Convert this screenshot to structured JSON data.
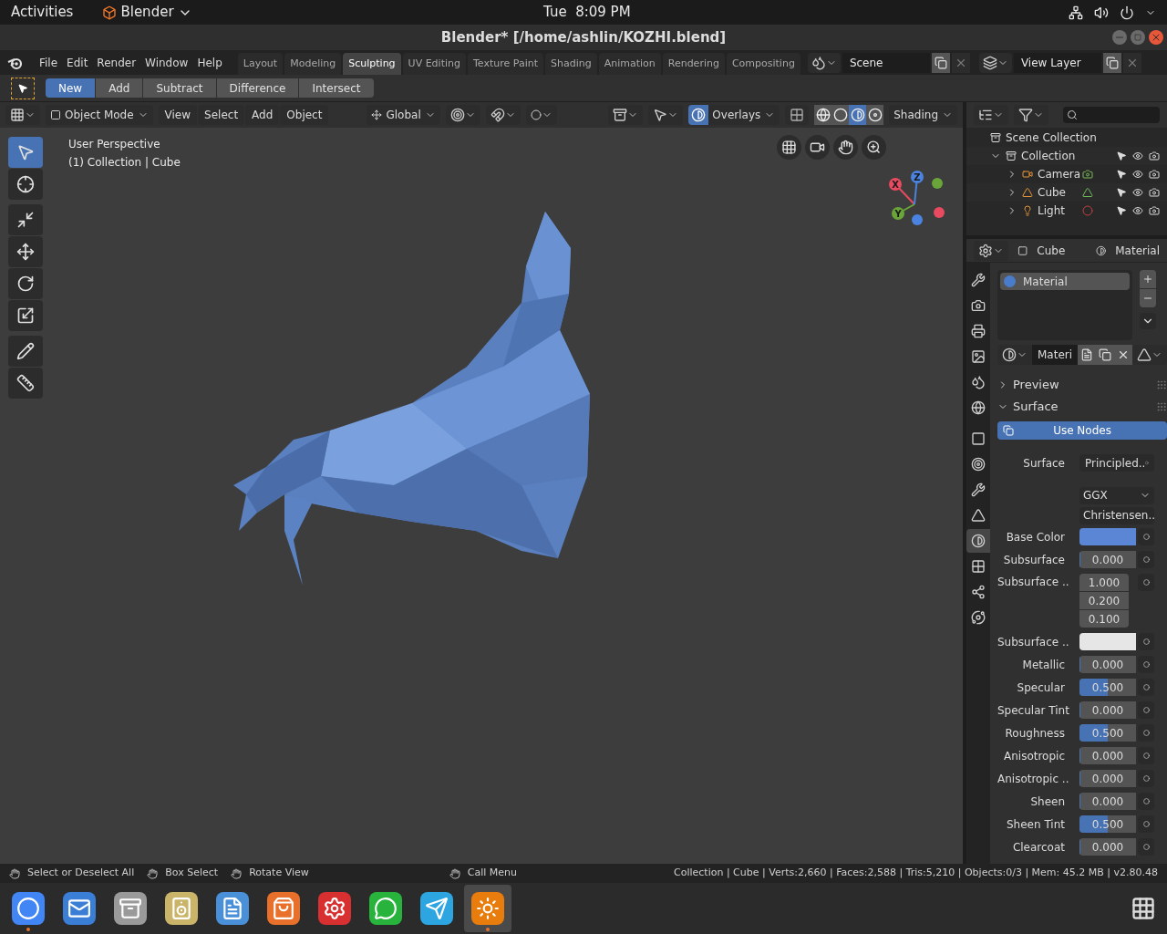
{
  "system_bar": {
    "activities": "Activities",
    "app_menu": "Blender",
    "clock": "Tue  8:09 PM"
  },
  "window": {
    "title": "Blender* [/home/ashlin/KOZHI.blend]"
  },
  "menu": [
    "File",
    "Edit",
    "Render",
    "Window",
    "Help"
  ],
  "workspace_tabs": [
    {
      "label": "Layout",
      "selected": false
    },
    {
      "label": "Modeling",
      "selected": false
    },
    {
      "label": "Sculpting",
      "selected": true
    },
    {
      "label": "UV Editing",
      "selected": false
    },
    {
      "label": "Texture Paint",
      "selected": false
    },
    {
      "label": "Shading",
      "selected": false
    },
    {
      "label": "Animation",
      "selected": false
    },
    {
      "label": "Rendering",
      "selected": false
    },
    {
      "label": "Compositing",
      "selected": false
    }
  ],
  "scene": "Scene",
  "view_layer": "View Layer",
  "tool_modes": [
    {
      "label": "New",
      "selected": true
    },
    {
      "label": "Add",
      "selected": false
    },
    {
      "label": "Subtract",
      "selected": false
    },
    {
      "label": "Difference",
      "selected": false
    },
    {
      "label": "Intersect",
      "selected": false
    }
  ],
  "viewport_header": {
    "mode": "Object Mode",
    "menus": [
      "View",
      "Select",
      "Add",
      "Object"
    ],
    "orientation": "Global",
    "overlays": {
      "label": "Overlays",
      "on": true
    },
    "shading_label": "Shading",
    "shading_modes": [
      {
        "kind": "wireframe",
        "selected": false
      },
      {
        "kind": "solid",
        "selected": false
      },
      {
        "kind": "material",
        "selected": true
      },
      {
        "kind": "rendered",
        "selected": false
      }
    ]
  },
  "viewport": {
    "overlay_lines": [
      "User Perspective",
      "(1) Collection | Cube"
    ],
    "axes": [
      "X",
      "Y",
      "Z"
    ]
  },
  "tools": [
    {
      "kind": "select",
      "selected": true
    },
    {
      "kind": "cursor",
      "selected": false
    },
    {
      "kind": "transform",
      "selected": false
    },
    {
      "kind": "move",
      "selected": false
    },
    {
      "kind": "rotate",
      "selected": false
    },
    {
      "kind": "scale",
      "selected": false
    },
    {
      "kind": "annotate",
      "selected": false
    },
    {
      "kind": "measure",
      "selected": false
    }
  ],
  "outliner": {
    "root": "Scene Collection",
    "items": [
      {
        "label": "Collection",
        "expanded": true,
        "children": [
          {
            "label": "Camera",
            "kind": "camera",
            "expanded": false
          },
          {
            "label": "Cube",
            "kind": "mesh",
            "expanded": false
          },
          {
            "label": "Light",
            "kind": "light",
            "expanded": false
          }
        ]
      }
    ]
  },
  "properties": {
    "tabs": [
      {
        "kind": "tool",
        "selected": false
      },
      {
        "kind": "render",
        "selected": false
      },
      {
        "kind": "output",
        "selected": false
      },
      {
        "kind": "view_layer",
        "selected": false
      },
      {
        "kind": "scene",
        "selected": false
      },
      {
        "kind": "world",
        "selected": false
      },
      {
        "kind": "object",
        "selected": false
      },
      {
        "kind": "constraints",
        "selected": false
      },
      {
        "kind": "modifiers",
        "selected": false
      },
      {
        "kind": "data",
        "selected": false
      },
      {
        "kind": "material",
        "selected": true
      },
      {
        "kind": "texture",
        "selected": false
      },
      {
        "kind": "particles",
        "selected": false
      },
      {
        "kind": "physics",
        "selected": false
      }
    ],
    "breadcrumb": [
      "Cube",
      "Material"
    ],
    "slots": [
      {
        "name": "Material",
        "selected": true
      }
    ],
    "material_name": "Materi",
    "panels": [
      {
        "label": "Preview",
        "expanded": false
      },
      {
        "label": "Surface",
        "expanded": true
      }
    ],
    "use_nodes": "Use Nodes",
    "fields": [
      {
        "kind": "shader",
        "label": "Surface",
        "value": "Principled.."
      },
      {
        "kind": "dropdown",
        "value": "GGX"
      },
      {
        "kind": "dropdown",
        "value": "Christensen.."
      },
      {
        "kind": "color",
        "label": "Base Color",
        "color": "#5b86d6"
      },
      {
        "kind": "slider",
        "label": "Subsurface",
        "value": "0.000",
        "level": 0
      },
      {
        "kind": "vector",
        "label": "Subsurface ..",
        "values": [
          "1.000",
          "0.200",
          "0.100"
        ]
      },
      {
        "kind": "color",
        "label": "Subsurface ..",
        "color": "#e6e6e6"
      },
      {
        "kind": "slider",
        "label": "Metallic",
        "value": "0.000",
        "level": 0
      },
      {
        "kind": "slider",
        "label": "Specular",
        "value": "0.500",
        "level": 0.5
      },
      {
        "kind": "slider",
        "label": "Specular Tint",
        "value": "0.000",
        "level": 0
      },
      {
        "kind": "slider",
        "label": "Roughness",
        "value": "0.500",
        "level": 0.5
      },
      {
        "kind": "slider",
        "label": "Anisotropic",
        "value": "0.000",
        "level": 0
      },
      {
        "kind": "slider",
        "label": "Anisotropic ..",
        "value": "0.000",
        "level": 0
      },
      {
        "kind": "slider",
        "label": "Sheen",
        "value": "0.000",
        "level": 0
      },
      {
        "kind": "slider",
        "label": "Sheen Tint",
        "value": "0.500",
        "level": 0.5
      },
      {
        "kind": "slider",
        "label": "Clearcoat",
        "value": "0.000",
        "level": 0
      }
    ]
  },
  "status_bar": {
    "hints": [
      "Select or Deselect All",
      "Box Select",
      "Rotate View",
      "Call Menu"
    ],
    "stats": "Collection | Cube | Verts:2,660 | Faces:2,588 | Tris:5,210 | Objects:0/3 | Mem: 45.2 MB | v2.80.48"
  },
  "dock": [
    {
      "kind": "browser",
      "running": true,
      "selected": false
    },
    {
      "kind": "mail",
      "running": false,
      "selected": false
    },
    {
      "kind": "files",
      "running": false,
      "selected": false
    },
    {
      "kind": "speaker",
      "running": false,
      "selected": false
    },
    {
      "kind": "document",
      "running": false,
      "selected": false
    },
    {
      "kind": "store",
      "running": false,
      "selected": false
    },
    {
      "kind": "gear",
      "running": false,
      "selected": false
    },
    {
      "kind": "chat",
      "running": false,
      "selected": false
    },
    {
      "kind": "plane",
      "running": false,
      "selected": false
    },
    {
      "kind": "blender",
      "running": true,
      "selected": true
    }
  ]
}
